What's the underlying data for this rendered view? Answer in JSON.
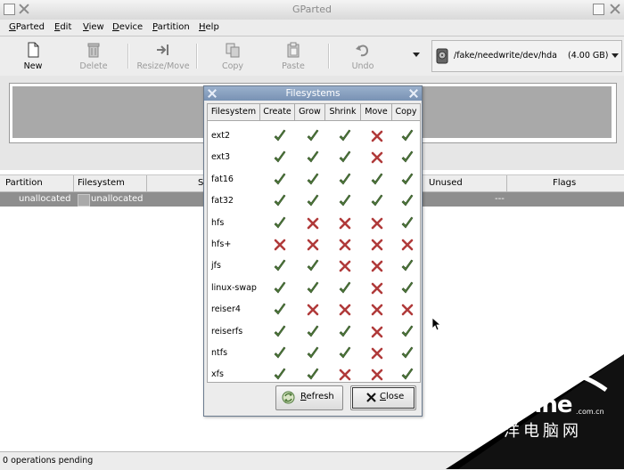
{
  "window": {
    "title": "GParted"
  },
  "menubar": [
    {
      "label": "GParted",
      "key": "G",
      "rest": "Parted"
    },
    {
      "label": "Edit",
      "key": "E",
      "rest": "dit"
    },
    {
      "label": "View",
      "key": "V",
      "rest": "iew"
    },
    {
      "label": "Device",
      "key": "D",
      "rest": "evice"
    },
    {
      "label": "Partition",
      "key": "P",
      "rest": "artition"
    },
    {
      "label": "Help",
      "key": "H",
      "rest": "elp"
    }
  ],
  "toolbar": {
    "new": "New",
    "delete": "Delete",
    "resize_move": "Resize/Move",
    "copy": "Copy",
    "paste": "Paste",
    "undo": "Undo"
  },
  "device": {
    "path": "/fake/needwrite/dev/hda",
    "size": "(4.00 GB)"
  },
  "partition_list": {
    "columns": [
      "Partition",
      "Filesystem",
      "S",
      "Unused",
      "Flags"
    ],
    "rows": [
      {
        "partition": "unallocated",
        "filesystem": "unallocated",
        "unused": "---"
      }
    ]
  },
  "status": {
    "text": "0 operations pending"
  },
  "dialog": {
    "title": "Filesystems",
    "columns": [
      "Filesystem",
      "Create",
      "Grow",
      "Shrink",
      "Move",
      "Copy"
    ],
    "rows": [
      {
        "name": "ext2",
        "support": [
          true,
          true,
          true,
          false,
          true
        ]
      },
      {
        "name": "ext3",
        "support": [
          true,
          true,
          true,
          false,
          true
        ]
      },
      {
        "name": "fat16",
        "support": [
          true,
          true,
          true,
          true,
          true
        ]
      },
      {
        "name": "fat32",
        "support": [
          true,
          true,
          true,
          true,
          true
        ]
      },
      {
        "name": "hfs",
        "support": [
          true,
          false,
          false,
          false,
          true
        ]
      },
      {
        "name": "hfs+",
        "support": [
          false,
          false,
          false,
          false,
          false
        ]
      },
      {
        "name": "jfs",
        "support": [
          true,
          true,
          false,
          false,
          true
        ]
      },
      {
        "name": "linux-swap",
        "support": [
          true,
          true,
          true,
          false,
          true
        ]
      },
      {
        "name": "reiser4",
        "support": [
          true,
          false,
          false,
          false,
          false
        ]
      },
      {
        "name": "reiserfs",
        "support": [
          true,
          true,
          true,
          false,
          true
        ]
      },
      {
        "name": "ntfs",
        "support": [
          true,
          true,
          true,
          false,
          true
        ]
      },
      {
        "name": "xfs",
        "support": [
          true,
          true,
          false,
          false,
          true
        ]
      }
    ],
    "refresh_key": "R",
    "refresh_rest": "efresh",
    "close_key": "C",
    "close_rest": "lose"
  },
  "watermark": {
    "brand": "PConline",
    "suffix": ".com.cn",
    "chinese": "太平洋电脑网"
  },
  "colors": {
    "check": "#4e7a3a",
    "cross": "#b03a3a",
    "dialog_title": "#7892b4",
    "selection": "#8e8e8e"
  }
}
